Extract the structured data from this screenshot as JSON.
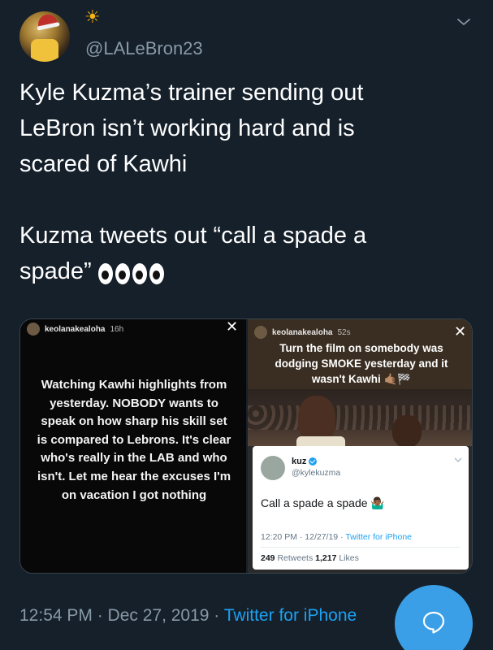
{
  "tweet": {
    "handle": "@LALeBron23",
    "name_emoji": "☀",
    "text_line1": "Kyle Kuzma’s trainer sending out",
    "text_line2": "LeBron isn’t working hard and is",
    "text_line3": "scared of Kawhi",
    "text_line4": "Kuzma tweets out “call a spade a",
    "text_line5": "spade”",
    "timestamp": "12:54 PM · Dec 27, 2019 · ",
    "source": "Twitter for iPhone"
  },
  "icons": {
    "caret": "chevron-down-icon",
    "compose": "reply-bubble-icon",
    "close": "close-icon"
  },
  "story_left": {
    "user": "keolanakealoha",
    "time": "16h",
    "close": "✕",
    "caption": "Watching Kawhi highlights from yesterday. NOBODY wants to speak on how sharp his skill set is compared to Lebrons. It's clear who's really in the LAB and who isn't. Let me hear the excuses I'm on vacation I got nothing"
  },
  "story_right": {
    "user": "keolanakealoha",
    "time": "52s",
    "close": "✕",
    "caption": "Turn the film on somebody was dodging SMOKE yesterday and it wasn't Kawhi 🤙🏽🏁"
  },
  "embedded_tweet": {
    "name": "kuz",
    "handle": "@kylekuzma",
    "text": "Call a spade a spade 🤷🏾‍♂️",
    "time": "12:20 PM · 12/27/19 · ",
    "source": "Twitter for iPhone",
    "retweets": "249",
    "retweets_label": " Retweets ",
    "likes": "1,217",
    "likes_label": " Likes"
  },
  "colors": {
    "background": "#15202b",
    "accent": "#1da1f2",
    "fab": "#3a9fe6",
    "muted": "#8899a6"
  }
}
